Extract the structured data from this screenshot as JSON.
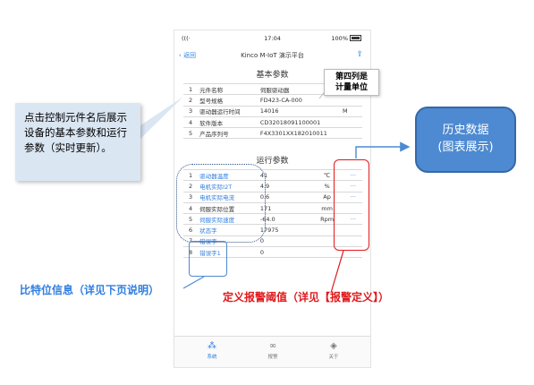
{
  "status_bar": {
    "signal": "(((·",
    "time": "17:04",
    "battery": "100%"
  },
  "nav": {
    "back_label": "返回",
    "title": "Kinco M-IoT 演示平台",
    "share_icon": "share-icon"
  },
  "basic": {
    "title": "基本参数",
    "rows": [
      {
        "num": "1",
        "name": "元件名称",
        "value": "伺服驱动器",
        "unit": ""
      },
      {
        "num": "2",
        "name": "型号规格",
        "value": "FD423-CA-000",
        "unit": ""
      },
      {
        "num": "3",
        "name": "驱动器运行时间",
        "value": "14016",
        "unit": "M"
      },
      {
        "num": "4",
        "name": "软件版本",
        "value": "CD32018091100001",
        "unit": ""
      },
      {
        "num": "5",
        "name": "产品序列号",
        "value": "F4X3301XX182010011",
        "unit": ""
      }
    ]
  },
  "running": {
    "title": "运行参数",
    "rows": [
      {
        "num": "1",
        "name": "驱动器温度",
        "value": "41",
        "unit": "℃",
        "action": "···",
        "link": true
      },
      {
        "num": "2",
        "name": "电机实际I2T",
        "value": "4.9",
        "unit": "%",
        "action": "···",
        "link": true
      },
      {
        "num": "3",
        "name": "电机实际电流",
        "value": "0.6",
        "unit": "Ap",
        "action": "···",
        "link": true
      },
      {
        "num": "4",
        "name": "伺服实际位置",
        "value": "171",
        "unit": "mm",
        "action": "",
        "link": false
      },
      {
        "num": "5",
        "name": "伺服实际速度",
        "value": "-64.0",
        "unit": "Rpm",
        "action": "···",
        "link": true
      },
      {
        "num": "6",
        "name": "状态字",
        "value": "17975",
        "unit": "",
        "action": "",
        "link": true
      },
      {
        "num": "7",
        "name": "错误字",
        "value": "0",
        "unit": "",
        "action": "",
        "link": true
      },
      {
        "num": "8",
        "name": "错误字1",
        "value": "0",
        "unit": "",
        "action": "",
        "link": true
      }
    ]
  },
  "tabs": [
    {
      "label": "系统",
      "icon": "hub-icon",
      "glyph": "⁂",
      "active": true
    },
    {
      "label": "报警",
      "icon": "link-icon",
      "glyph": "∞",
      "active": false
    },
    {
      "label": "关于",
      "icon": "cube-icon",
      "glyph": "◈",
      "active": false
    }
  ],
  "annotations": {
    "left_callout": "点击控制元件名后展示设备的基本参数和运行参数（实时更新）。",
    "note": [
      "第四列是",
      "计量单位"
    ],
    "history": [
      "历史数据",
      "(图表展示)"
    ],
    "bits_label": "比特位信息（详见下页说明）",
    "alarm_label": "定义报警阈值（详见【报警定义】）"
  },
  "colors": {
    "accent_blue": "#2f7ee0",
    "callout_blue": "#4d8ad1",
    "alarm_red": "#e0191b",
    "dotted_navy": "#2e4f88"
  }
}
